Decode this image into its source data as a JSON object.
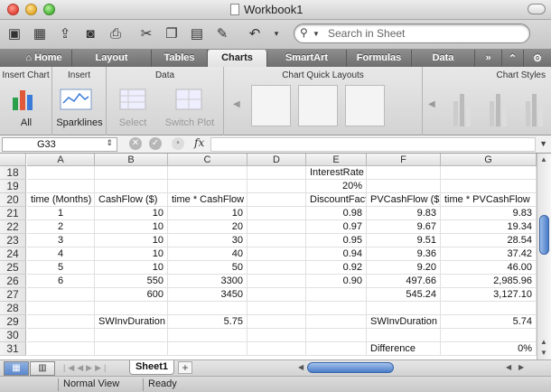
{
  "window": {
    "title": "Workbook1"
  },
  "search": {
    "placeholder": "Search in Sheet"
  },
  "ribbon_tabs": [
    "Home",
    "Layout",
    "Tables",
    "Charts",
    "SmartArt",
    "Formulas",
    "Data"
  ],
  "ribbon_active_tab": "Charts",
  "ribbon": {
    "insert_chart": {
      "title": "Insert Chart",
      "all_label": "All"
    },
    "insert": {
      "title": "Insert",
      "sparklines_label": "Sparklines"
    },
    "data": {
      "title": "Data",
      "select_label": "Select",
      "switch_plot_label": "Switch Plot"
    },
    "quick_layouts": {
      "title": "Chart Quick Layouts"
    },
    "chart_styles": {
      "title": "Chart Styles"
    }
  },
  "formula_bar": {
    "name_box": "G33",
    "fx_label": "fx",
    "formula": ""
  },
  "columns": [
    "A",
    "B",
    "C",
    "D",
    "E",
    "F",
    "G"
  ],
  "rows": [
    {
      "num": "18",
      "A": "",
      "B": "",
      "C": "",
      "D": "",
      "E": "InterestRate",
      "F": "",
      "G": ""
    },
    {
      "num": "19",
      "A": "",
      "B": "",
      "C": "",
      "D": "",
      "E": "20%",
      "F": "",
      "G": ""
    },
    {
      "num": "20",
      "A": "time (Months)",
      "B": "CashFlow ($)",
      "C": "time * CashFlow",
      "D": "",
      "E": "DiscountFact",
      "F": "PVCashFlow ($)",
      "G": "time * PVCashFlow"
    },
    {
      "num": "21",
      "A": "1",
      "B": "10",
      "C": "10",
      "D": "",
      "E": "0.98",
      "F": "9.83",
      "G": "9.83"
    },
    {
      "num": "22",
      "A": "2",
      "B": "10",
      "C": "20",
      "D": "",
      "E": "0.97",
      "F": "9.67",
      "G": "19.34"
    },
    {
      "num": "23",
      "A": "3",
      "B": "10",
      "C": "30",
      "D": "",
      "E": "0.95",
      "F": "9.51",
      "G": "28.54"
    },
    {
      "num": "24",
      "A": "4",
      "B": "10",
      "C": "40",
      "D": "",
      "E": "0.94",
      "F": "9.36",
      "G": "37.42"
    },
    {
      "num": "25",
      "A": "5",
      "B": "10",
      "C": "50",
      "D": "",
      "E": "0.92",
      "F": "9.20",
      "G": "46.00"
    },
    {
      "num": "26",
      "A": "6",
      "B": "550",
      "C": "3300",
      "D": "",
      "E": "0.90",
      "F": "497.66",
      "G": "2,985.96"
    },
    {
      "num": "27",
      "A": "",
      "B": "600",
      "C": "3450",
      "D": "",
      "E": "",
      "F": "545.24",
      "G": "3,127.10"
    },
    {
      "num": "28",
      "A": "",
      "B": "",
      "C": "",
      "D": "",
      "E": "",
      "F": "",
      "G": ""
    },
    {
      "num": "29",
      "A": "",
      "B": "SWInvDuration",
      "C": "5.75",
      "D": "",
      "E": "",
      "F": "SWInvDuration",
      "G": "5.74"
    },
    {
      "num": "30",
      "A": "",
      "B": "",
      "C": "",
      "D": "",
      "E": "",
      "F": "",
      "G": ""
    },
    {
      "num": "31",
      "A": "",
      "B": "",
      "C": "",
      "D": "",
      "E": "",
      "F": "Difference",
      "G": "0%"
    }
  ],
  "sheets": [
    "Sheet1"
  ],
  "status": {
    "view": "Normal View",
    "state": "Ready"
  }
}
